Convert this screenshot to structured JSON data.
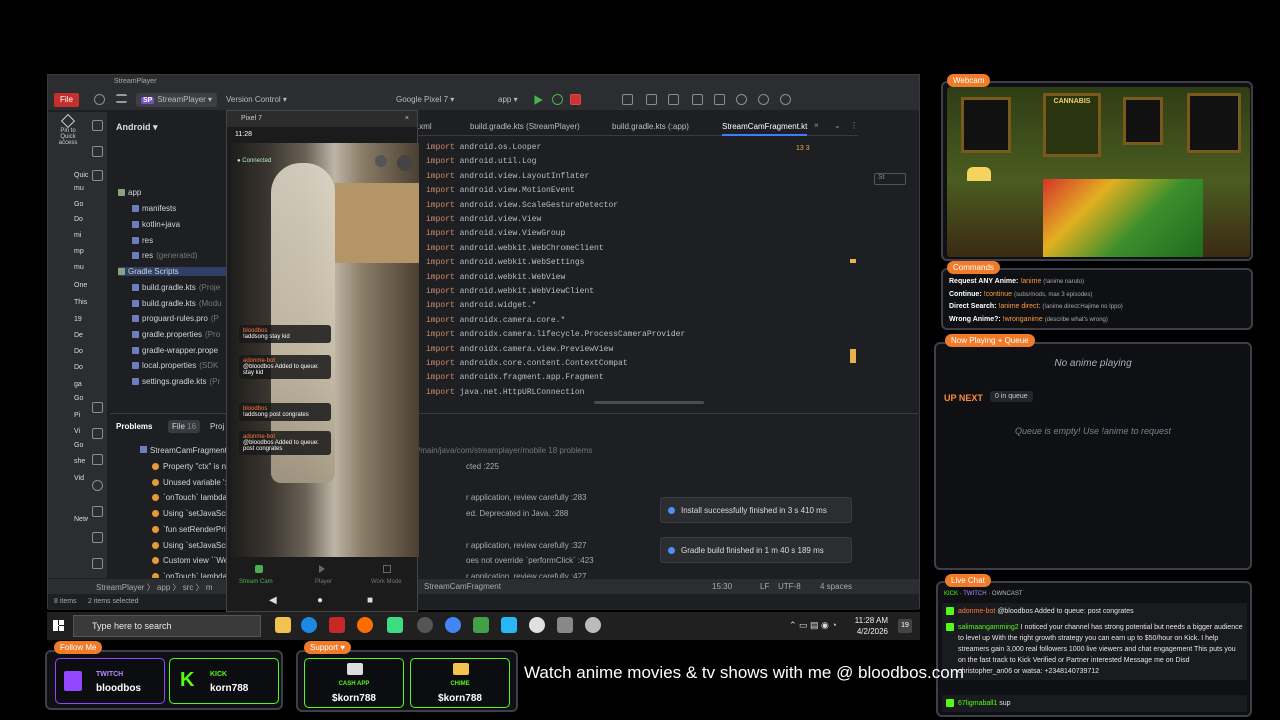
{
  "ide": {
    "window_title": "StreamPlayer",
    "file_button": "File",
    "project_name": "StreamPlayer",
    "project_badge": "SP",
    "vcs": "Version Control",
    "device": "Google Pixel 7",
    "run_config": "app",
    "pin": "Pin to Quick access",
    "project_view": "Android",
    "tree": [
      {
        "label": "app",
        "extra": ""
      },
      {
        "label": "manifests",
        "extra": ""
      },
      {
        "label": "kotlin+java",
        "extra": ""
      },
      {
        "label": "res",
        "extra": ""
      },
      {
        "label": "res",
        "extra": "(generated)"
      },
      {
        "label": "Gradle Scripts",
        "extra": ""
      },
      {
        "label": "build.gradle.kts",
        "extra": "(Proje"
      },
      {
        "label": "build.gradle.kts",
        "extra": "(Modu"
      },
      {
        "label": "proguard-rules.pro",
        "extra": "(P"
      },
      {
        "label": "gradle.properties",
        "extra": "(Pro"
      },
      {
        "label": "gradle-wrapper.prope",
        "extra": ""
      },
      {
        "label": "local.properties",
        "extra": "(SDK"
      },
      {
        "label": "settings.gradle.kts",
        "extra": "(Pr"
      }
    ],
    "explorer_items": [
      "Quic",
      "mu",
      "Go",
      "Do",
      "mi",
      "mp",
      "mu",
      "One",
      "This",
      "19",
      "De",
      "Do",
      "Do",
      "ga",
      "Go",
      "Pi",
      "Vi",
      "Go",
      "she",
      "Vid",
      "Netw"
    ],
    "tabs": [
      ".xml",
      "build.gradle.kts (StreamPlayer)",
      "build.gradle.kts (:app)",
      "StreamCamFragment.kt"
    ],
    "inspection": "13  3",
    "code": [
      "android.os.Looper",
      "android.util.Log",
      "android.view.LayoutInflater",
      "android.view.MotionEvent",
      "android.view.ScaleGestureDetector",
      "android.view.View",
      "android.view.ViewGroup",
      "android.webkit.WebChromeClient",
      "android.webkit.WebSettings",
      "android.webkit.WebView",
      "android.webkit.WebViewClient",
      "android.widget.*",
      "androidx.camera.core.*",
      "androidx.camera.lifecycle.ProcessCameraProvider",
      "androidx.camera.view.PreviewView",
      "androidx.core.content.ContextCompat",
      "androidx.fragment.app.Fragment",
      "java.net.HttpURLConnection"
    ],
    "code_keyword": "import",
    "search_placeholder": "St",
    "problems_tab": "Problems",
    "file_tab": "File",
    "file_count": "16",
    "proj_tab": "Proj",
    "problem_file": "StreamCamFragment",
    "problem_path": "c/main/java/com/streamplayer/mobile  18 problems",
    "problems": [
      {
        "left": "Property \"ctx\" is n",
        "right": "cted :225"
      },
      {
        "left": "Unused variable ':",
        "right": ""
      },
      {
        "left": "`onTouch` lambda",
        "right": "r application, review carefully :283"
      },
      {
        "left": "Using `setJavaScr",
        "right": "ed. Deprecated in Java. :288"
      },
      {
        "left": "`fun setRenderPrio",
        "right": ""
      },
      {
        "left": "Using `setJavaScr",
        "right": "r application, review carefully :327"
      },
      {
        "left": "Custom view ``We",
        "right": "oes not override `performClick` :423"
      },
      {
        "left": "`onTouch` lambda",
        "right": "r application, review carefully :427"
      }
    ],
    "toasts": [
      "Install successfully finished in 3 s 410 ms",
      "Gradle build finished in 1 m 40 s 189 ms"
    ],
    "breadcrumb": [
      "StreamPlayer",
      "app",
      "src",
      "m"
    ],
    "breadcrumb_file": "StreamCamFragment",
    "status": {
      "position": "15:30",
      "line_sep": "LF",
      "encoding": "UTF-8",
      "indent": "4 spaces"
    },
    "items_count": "8 items",
    "items_selected": "2 items selected"
  },
  "emulator": {
    "title": "Pixel 7",
    "time": "11:28",
    "connected": "Connected",
    "chat": [
      {
        "name": "bloodbos",
        "text": "!addsong stay kid"
      },
      {
        "name": "adonme-bot",
        "text": "@bloodbos Added to queue: stay kid"
      },
      {
        "name": "bloodbos",
        "text": "!addsong post congrates"
      },
      {
        "name": "adonme-bot",
        "text": "@bloodbos Added to queue: post congrates"
      }
    ],
    "nav": [
      "Stream Cam",
      "Player",
      "Work Mode"
    ]
  },
  "taskbar": {
    "search_placeholder": "Type here to search",
    "time": "11:28 AM",
    "date": "4/2/2026",
    "notif": "19"
  },
  "overlay": {
    "webcam_tag": "Webcam",
    "webcam_sign": "CANNABIS",
    "commands_tag": "Commands",
    "commands": [
      {
        "label": "Request ANY Anime:",
        "cmd": "!anime",
        "desc": "(!anime naruto)"
      },
      {
        "label": "Continue:",
        "cmd": "!continue",
        "desc": "(subs/mods, max 3 episodes)"
      },
      {
        "label": "Direct Search:",
        "cmd": "!anime direct:",
        "desc": "(!anime direct:Hajime no Ippo)"
      },
      {
        "label": "Wrong Anime?:",
        "cmd": "!wronganime",
        "desc": "(describe what's wrong)"
      }
    ],
    "now_playing_tag": "Now Playing + Queue",
    "now_playing": "No anime playing",
    "up_next": "UP NEXT",
    "queue_count": "0 in queue",
    "queue_empty": "Queue is empty! Use !anime to request",
    "live_chat_tag": "Live Chat",
    "chat_platforms": [
      "KICK",
      "TWITCH",
      "OWNCAST"
    ],
    "chat": [
      {
        "user": "adonme-bot",
        "text": "@bloodbos Added to queue: post congrates",
        "bot": true
      },
      {
        "user": "salimaangamming2",
        "text": "I noticed your channel has strong potential but needs a bigger audience to level up With the right growth strategy you can earn up to $50/hour on Kick. I help streamers gain 3,000 real followers 1000 live viewers and chat engagement This puts you on the fast track to Kick Verified or Partner interested Message me on Disd christopher_an06 or watsa: +2348140739712",
        "bot": false
      },
      {
        "user": "67ligmaball1",
        "text": "sup",
        "bot": false
      }
    ],
    "follow_tag": "Follow Me",
    "twitch_label": "TWITCH",
    "twitch_user": "bloodbos",
    "kick_label": "KICK",
    "kick_user": "korn788",
    "support_tag": "Support",
    "cashapp_label": "CASH APP",
    "cashapp_user": "$korn788",
    "chime_label": "CHIME",
    "chime_user": "$korn788",
    "banner": "Watch anime movies & tv shows with me @ bloodbos.com"
  },
  "colors": {
    "accent": "#f07b2a",
    "kick": "#53fc18",
    "twitch": "#9146ff",
    "ide_bg": "#1e1f22"
  }
}
